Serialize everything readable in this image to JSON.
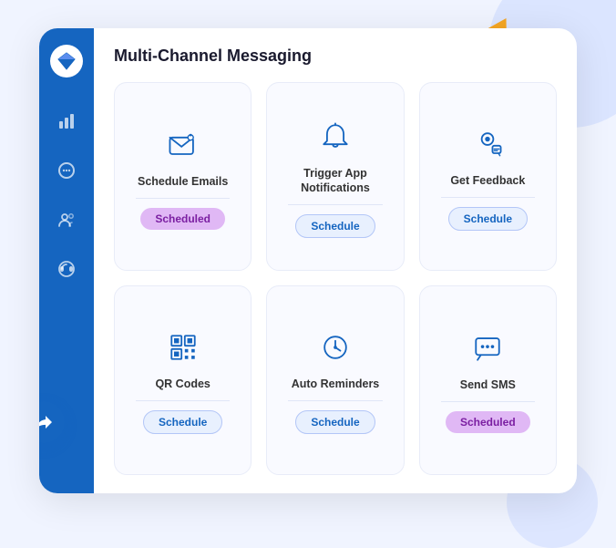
{
  "page": {
    "title": "Multi-Channel Messaging"
  },
  "sidebar": {
    "logo_label": "diamond",
    "icons": [
      {
        "name": "chart-icon",
        "symbol": "📊"
      },
      {
        "name": "message-icon",
        "symbol": "💬"
      },
      {
        "name": "users-icon",
        "symbol": "👥"
      },
      {
        "name": "support-icon",
        "symbol": "🎧"
      }
    ]
  },
  "grid": {
    "cells": [
      {
        "id": "schedule-emails",
        "label": "Schedule Emails",
        "badge": "Scheduled",
        "badge_type": "scheduled"
      },
      {
        "id": "trigger-notifications",
        "label": "Trigger App Notifications",
        "badge": "Schedule",
        "badge_type": "schedule"
      },
      {
        "id": "get-feedback",
        "label": "Get Feedback",
        "badge": "Schedule",
        "badge_type": "schedule"
      },
      {
        "id": "qr-codes",
        "label": "QR Codes",
        "badge": "Schedule",
        "badge_type": "schedule"
      },
      {
        "id": "auto-reminders",
        "label": "Auto Reminders",
        "badge": "Schedule",
        "badge_type": "schedule"
      },
      {
        "id": "send-sms",
        "label": "Send SMS",
        "badge": "Scheduled",
        "badge_type": "scheduled"
      }
    ]
  },
  "fab": {
    "icon": "thumbs-up",
    "symbol": "👍"
  }
}
